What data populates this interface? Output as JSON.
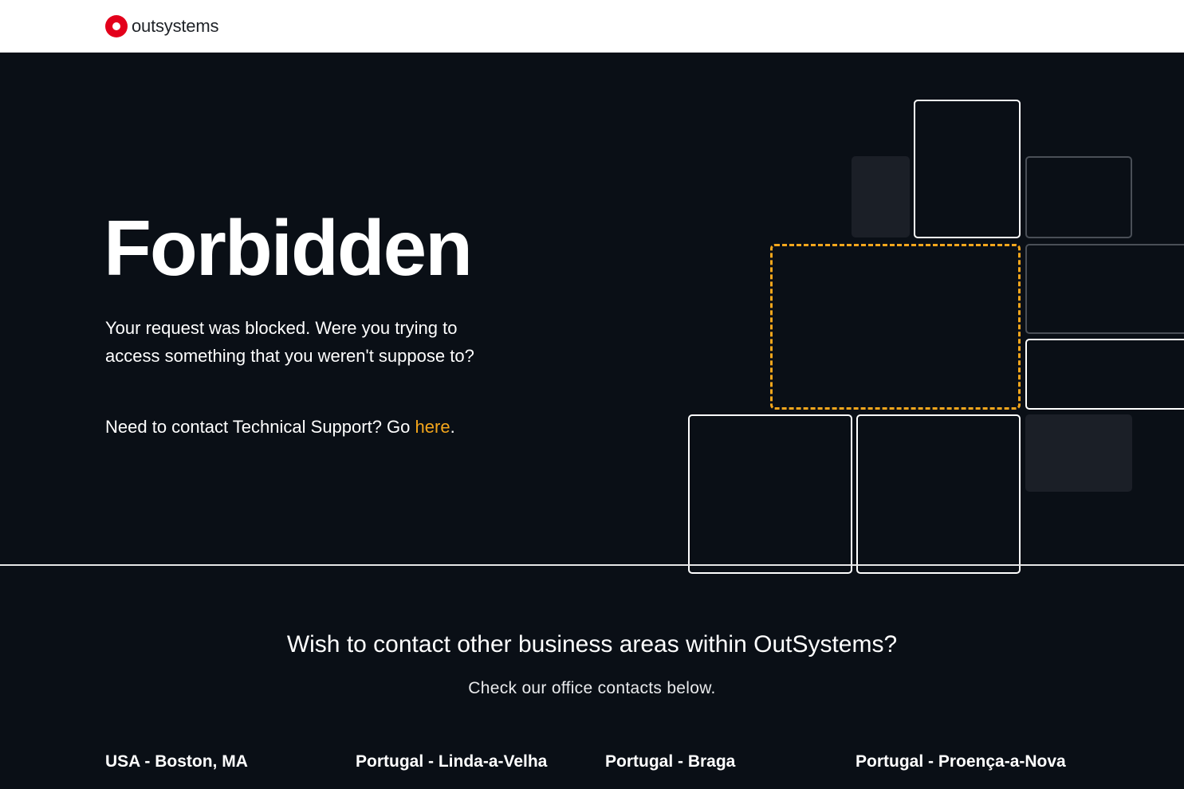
{
  "header": {
    "logo_text": "outsystems"
  },
  "hero": {
    "title": "Forbidden",
    "description": "Your request was blocked. Were you trying to access something that you weren't suppose to?",
    "support_prefix": "Need to contact Technical Support? Go ",
    "support_link": "here",
    "support_suffix": "."
  },
  "colors": {
    "background": "#0a0f16",
    "accent": "#f4a61c",
    "brand_red": "#e3001b"
  },
  "contacts": {
    "title": "Wish to contact other business areas within OutSystems?",
    "subtitle": "Check our office contacts below.",
    "offices": [
      {
        "name": "USA - Boston, MA"
      },
      {
        "name": "Portugal - Linda-a-Velha"
      },
      {
        "name": "Portugal - Braga"
      },
      {
        "name": "Portugal - Proença-a-Nova"
      }
    ]
  }
}
